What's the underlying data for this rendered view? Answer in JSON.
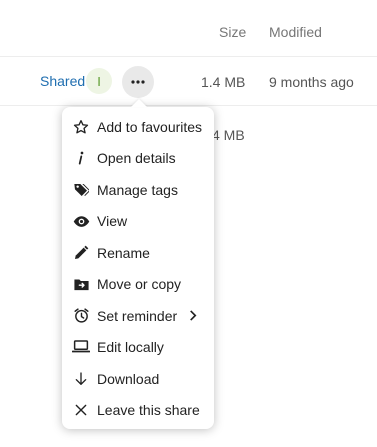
{
  "table": {
    "headers": {
      "size": "Size",
      "modified": "Modified"
    }
  },
  "file_row": {
    "shared_label": "Shared",
    "avatar_initial": "I",
    "size": "1.4 MB",
    "modified": "9 months ago"
  },
  "next_row": {
    "size_partial": "4 MB"
  },
  "menu": {
    "items": [
      {
        "label": "Add to favourites",
        "icon": "star-outline-icon"
      },
      {
        "label": "Open details",
        "icon": "info-icon"
      },
      {
        "label": "Manage tags",
        "icon": "tag-icon"
      },
      {
        "label": "View",
        "icon": "eye-icon"
      },
      {
        "label": "Rename",
        "icon": "pencil-icon"
      },
      {
        "label": "Move or copy",
        "icon": "folder-move-icon"
      },
      {
        "label": "Set reminder",
        "icon": "alarm-icon",
        "has_submenu": true
      },
      {
        "label": "Edit locally",
        "icon": "laptop-icon"
      },
      {
        "label": "Download",
        "icon": "arrow-down-icon"
      },
      {
        "label": "Leave this share",
        "icon": "close-icon"
      }
    ]
  },
  "colors": {
    "link": "#1f6eb0",
    "avatar_bg": "#eef5e4",
    "avatar_fg": "#5a9a2c",
    "more_button_bg": "#e9e9e9"
  }
}
